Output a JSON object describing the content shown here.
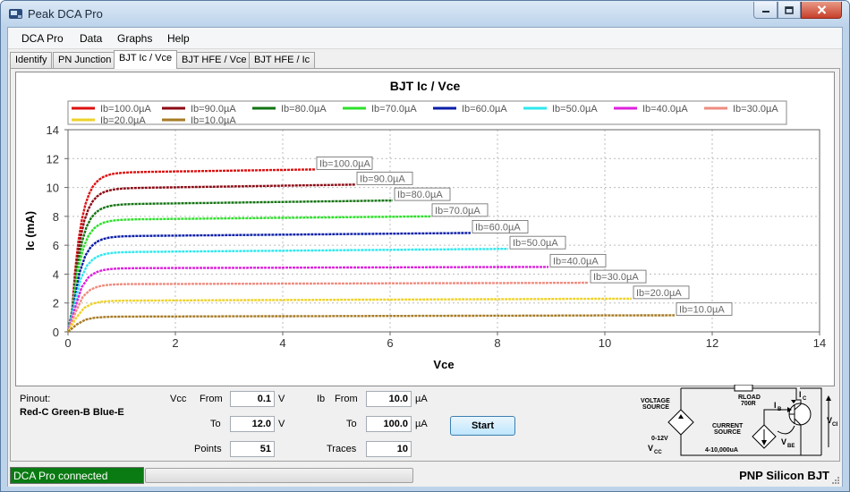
{
  "window": {
    "title": "Peak DCA Pro",
    "min": "0",
    "max": "1",
    "close": "r"
  },
  "menu": [
    "DCA Pro",
    "Data",
    "Graphs",
    "Help"
  ],
  "tabs": [
    "Identify",
    "PN Junction",
    "BJT Ic / Vce",
    "BJT HFE / Vce",
    "BJT HFE / Ic"
  ],
  "active_tab": 2,
  "chart_data": {
    "type": "line",
    "title": "BJT Ic / Vce",
    "xlabel": "Vce",
    "ylabel": "Ic (mA)",
    "xlim": [
      0,
      14
    ],
    "ylim": [
      0,
      14
    ],
    "xticks": [
      0,
      2,
      4,
      6,
      8,
      10,
      12,
      14
    ],
    "yticks": [
      0,
      2,
      4,
      6,
      8,
      10,
      12,
      14
    ],
    "grid": true,
    "legend": "top",
    "series": [
      {
        "name": "Ib=100.0µA",
        "color": "#dd1111",
        "sat": 11.0,
        "end_y": 11.25,
        "end_x": 4.6,
        "label": "Ib=100.0µA"
      },
      {
        "name": "Ib=90.0µA",
        "color": "#8b0a14",
        "sat": 9.9,
        "end_y": 10.2,
        "end_x": 5.35,
        "label": "Ib=90.0µA"
      },
      {
        "name": "Ib=80.0µA",
        "color": "#137312",
        "sat": 8.8,
        "end_y": 9.1,
        "end_x": 6.05,
        "label": "Ib=80.0µA"
      },
      {
        "name": "Ib=70.0µA",
        "color": "#2ee02b",
        "sat": 7.75,
        "end_y": 8.0,
        "end_x": 6.75,
        "label": "Ib=70.0µA"
      },
      {
        "name": "Ib=60.0µA",
        "color": "#0a1ea8",
        "sat": 6.6,
        "end_y": 6.85,
        "end_x": 7.5,
        "label": "Ib=60.0µA"
      },
      {
        "name": "Ib=50.0µA",
        "color": "#2ee8ee",
        "sat": 5.5,
        "end_y": 5.75,
        "end_x": 8.2,
        "label": "Ib=50.0µA"
      },
      {
        "name": "Ib=40.0µA",
        "color": "#dd22dd",
        "sat": 4.4,
        "end_y": 4.5,
        "end_x": 8.95,
        "label": "Ib=40.0µA"
      },
      {
        "name": "Ib=30.0µA",
        "color": "#ee8c80",
        "sat": 3.3,
        "end_y": 3.4,
        "end_x": 9.7,
        "label": "Ib=30.0µA"
      },
      {
        "name": "Ib=20.0µA",
        "color": "#eed22a",
        "sat": 2.15,
        "end_y": 2.3,
        "end_x": 10.5,
        "label": "Ib=20.0µA"
      },
      {
        "name": "Ib=10.0µA",
        "color": "#a67b25",
        "sat": 1.05,
        "end_y": 1.15,
        "end_x": 11.3,
        "label": "Ib=10.0µA"
      }
    ]
  },
  "controls": {
    "pinout_label": "Pinout:",
    "pinout_value": "Red-C Green-B Blue-E",
    "vcc_label": "Vcc",
    "from_label": "From",
    "to_label": "To",
    "points_label": "Points",
    "ib_label": "Ib",
    "traces_label": "Traces",
    "vcc_from": "0.1",
    "vcc_to": "12.0",
    "vcc_unit": "V",
    "points": "51",
    "ib_from": "10.0",
    "ib_to": "100.0",
    "ib_unit": "µA",
    "traces": "10",
    "start": "Start"
  },
  "schematic": {
    "voltage_source_1": "VOLTAGE",
    "voltage_source_2": "SOURCE",
    "voltage_range": "0-12V",
    "vcc": "V",
    "vcc_sub": "CC",
    "rload": "RLOAD",
    "rload_value": "700R",
    "current_source_1": "CURRENT",
    "current_source_2": "SOURCE",
    "current_range": "4-10,000uA",
    "ib": "I",
    "ib_sub": "B",
    "vbe": "V",
    "vbe_sub": "BE",
    "ic": "I",
    "ic_sub": "C",
    "vce": "V",
    "vce_sub": "CE"
  },
  "status": {
    "connection": "DCA Pro connected",
    "progress": 0,
    "device": "PNP Silicon BJT"
  }
}
